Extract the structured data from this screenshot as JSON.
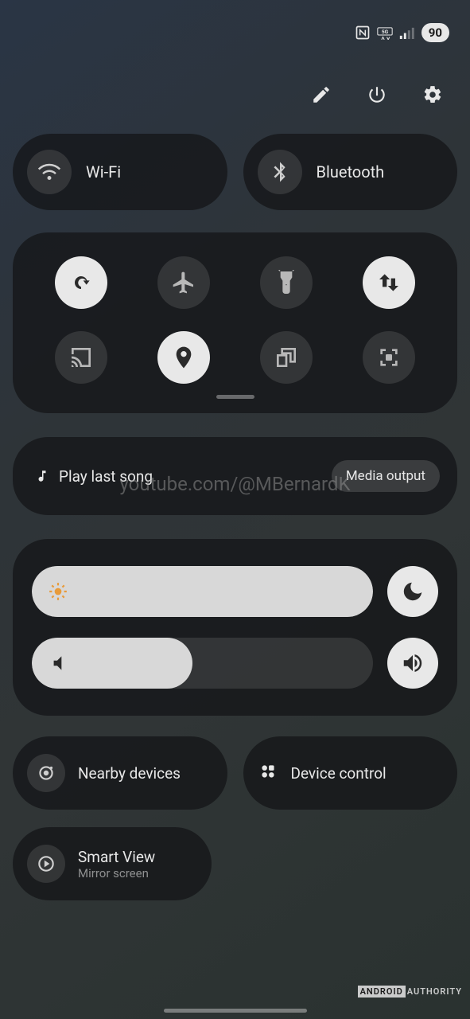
{
  "status": {
    "battery": "90"
  },
  "connectivity": {
    "wifi_label": "Wi-Fi",
    "bluetooth_label": "Bluetooth"
  },
  "media": {
    "play_last": "Play last song",
    "output_button": "Media output",
    "watermark": "youtube.com/@MBernardK"
  },
  "sliders": {
    "brightness_percent": 100,
    "volume_percent": 47
  },
  "bottom": {
    "nearby_label": "Nearby devices",
    "device_control_label": "Device control",
    "smartview_title": "Smart View",
    "smartview_sub": "Mirror screen"
  },
  "attribution": {
    "brand1": "ANDROID",
    "brand2": "AUTHORITY"
  }
}
